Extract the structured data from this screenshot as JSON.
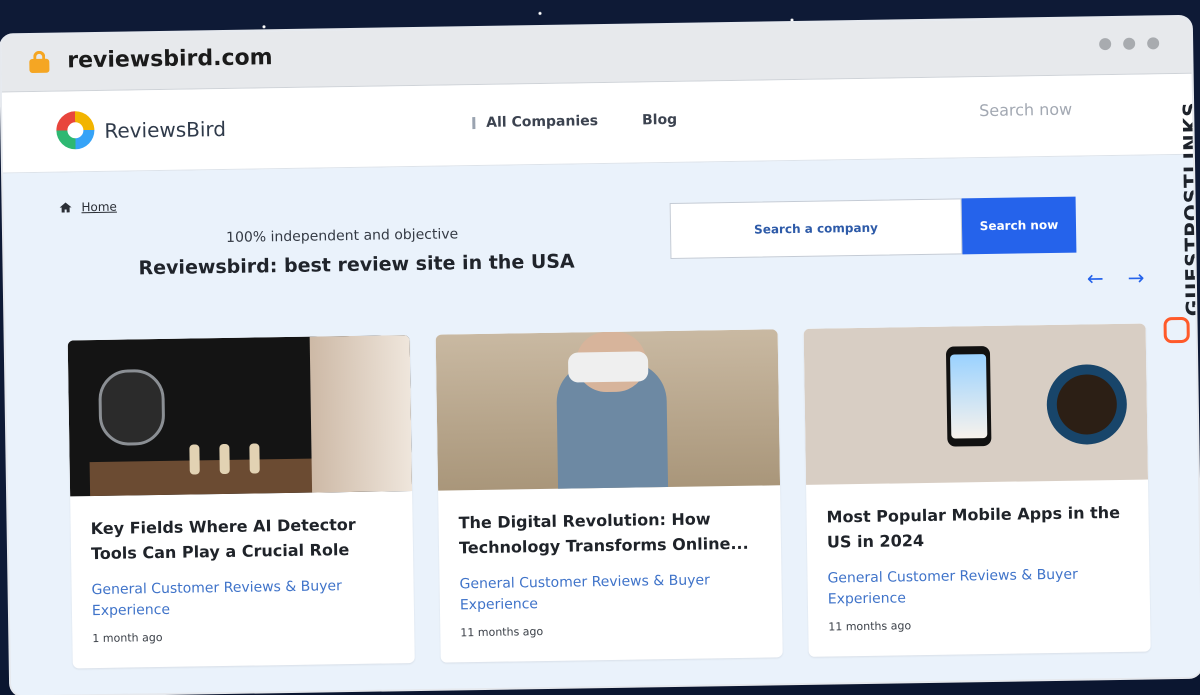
{
  "browser": {
    "url": "reviewsbird.com"
  },
  "site": {
    "brand": "ReviewsBird",
    "nav": {
      "all_companies": "All Companies",
      "blog": "Blog"
    },
    "header_search_placeholder": "Search now"
  },
  "hero": {
    "breadcrumb_home": "Home",
    "tagline": "100% independent and objective",
    "title": "Reviewsbird: best review site in the USA",
    "search_placeholder": "Search a company",
    "search_button": "Search now"
  },
  "pager": {
    "prev_icon": "←",
    "next_icon": "→"
  },
  "cards": [
    {
      "title": "Key Fields Where AI Detector Tools Can Play a Crucial Role",
      "category": "General Customer Reviews & Buyer Experience",
      "time": "1 month ago"
    },
    {
      "title": "The Digital Revolution: How Technology Transforms Online...",
      "category": "General Customer Reviews & Buyer Experience",
      "time": "11 months ago"
    },
    {
      "title": "Most Popular Mobile Apps in the US in 2024",
      "category": "General Customer Reviews & Buyer Experience",
      "time": "11 months ago"
    }
  ],
  "side_brand": {
    "text": "GUESTPOSTLINKS"
  },
  "colors": {
    "accent": "#2563eb",
    "link": "#3f73c9",
    "lock": "#f5a623",
    "brand_orange": "#ff5a2a"
  }
}
